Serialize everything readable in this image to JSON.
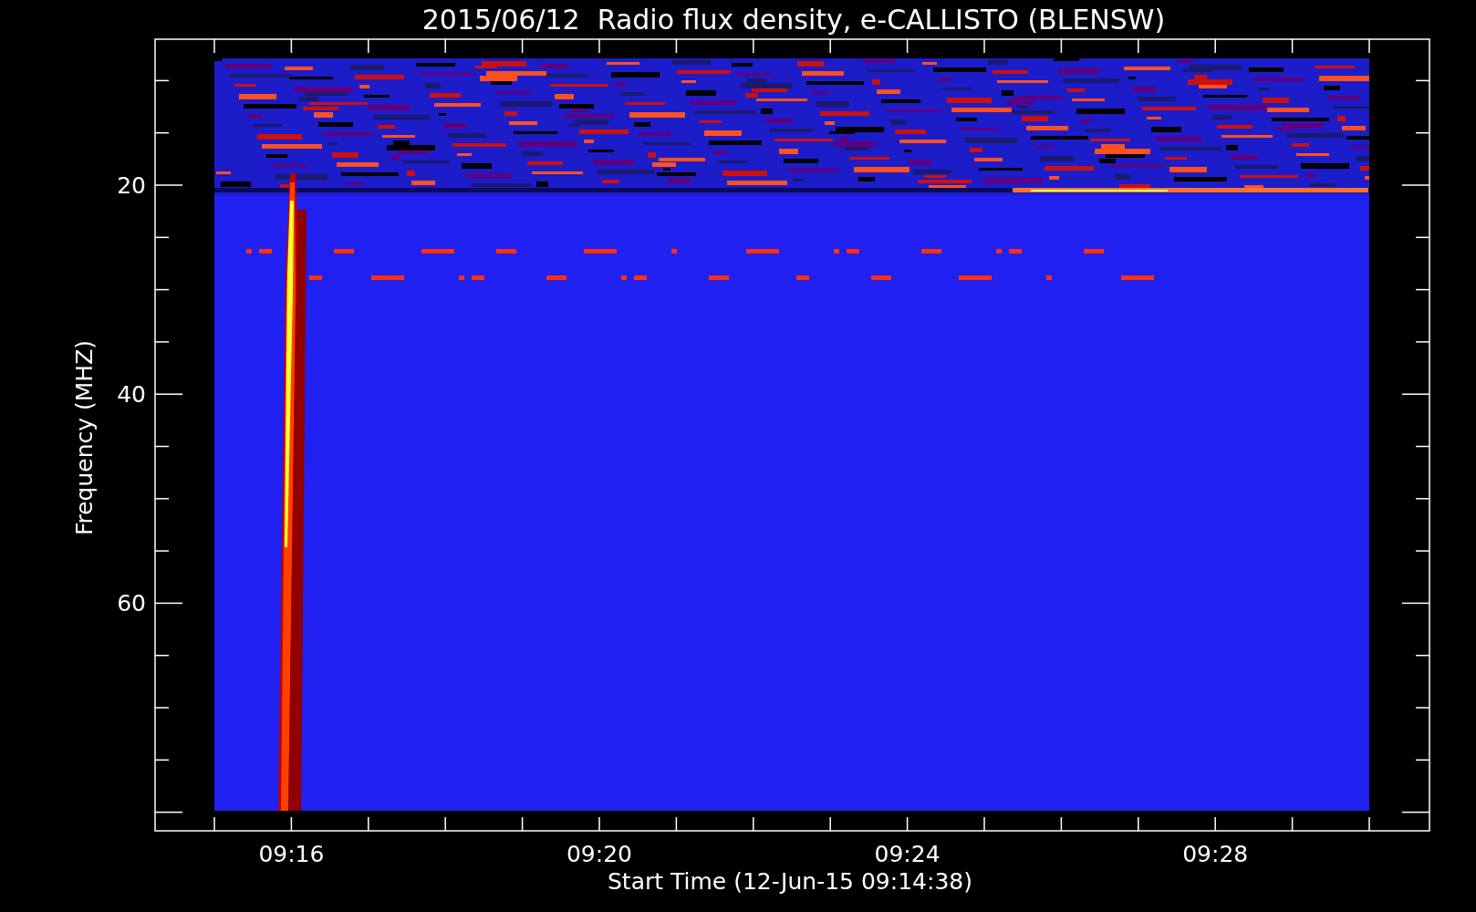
{
  "title": "2015/06/12  Radio flux density, e-CALLISTO (BLENSW)",
  "y_axis": {
    "label": "Frequency (MHZ)",
    "ticks": [
      "20",
      "40",
      "60"
    ]
  },
  "x_axis": {
    "label": "Start Time (12-Jun-15 09:14:38)",
    "ticks": [
      "09:16",
      "09:20",
      "09:24",
      "09:28"
    ]
  }
}
